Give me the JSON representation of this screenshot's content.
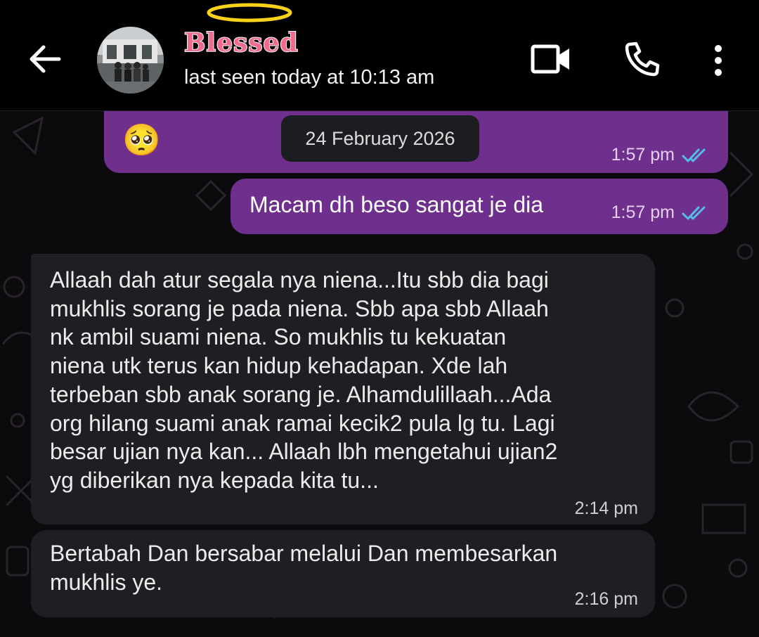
{
  "header": {
    "contact_name_sticker": "Blessed",
    "last_seen": "last seen today at 10:13 am"
  },
  "date_chip": "24 February 2026",
  "messages": [
    {
      "direction": "out",
      "text": "🥺",
      "time": "1:57 pm",
      "status": "read"
    },
    {
      "direction": "out",
      "text": "Macam dh beso sangat je dia",
      "time": "1:57 pm",
      "status": "read"
    },
    {
      "direction": "in",
      "lines": [
        "Allaah dah atur segala nya niena...Itu sbb dia bagi",
        "mukhlis sorang je pada niena. Sbb apa sbb Allaah",
        "nk ambil suami niena. So mukhlis tu kekuatan",
        "niena utk terus kan hidup kehadapan. Xde lah",
        "terbeban sbb anak sorang je. Alhamdulillaah...Ada",
        "org hilang suami anak ramai kecik2 pula lg tu. Lagi",
        "besar ujian nya kan... Allaah lbh mengetahui ujian2",
        "yg diberikan nya kepada kita tu..."
      ],
      "time": "2:14 pm"
    },
    {
      "direction": "in",
      "lines": [
        "Bertabah Dan bersabar melalui Dan membesarkan",
        "mukhlis ye."
      ],
      "time": "2:16 pm"
    }
  ],
  "icons": {
    "back": "arrow-left-icon",
    "video": "video-camera-icon",
    "call": "phone-icon",
    "more": "more-vertical-icon",
    "read_receipt": "double-check-icon"
  },
  "colors": {
    "header_bg": "#000000",
    "outgoing_bubble": "#6f2f8d",
    "incoming_bubble": "#1e1f23",
    "read_tick": "#53bdeb",
    "chat_bg": "#0b0b0d"
  }
}
